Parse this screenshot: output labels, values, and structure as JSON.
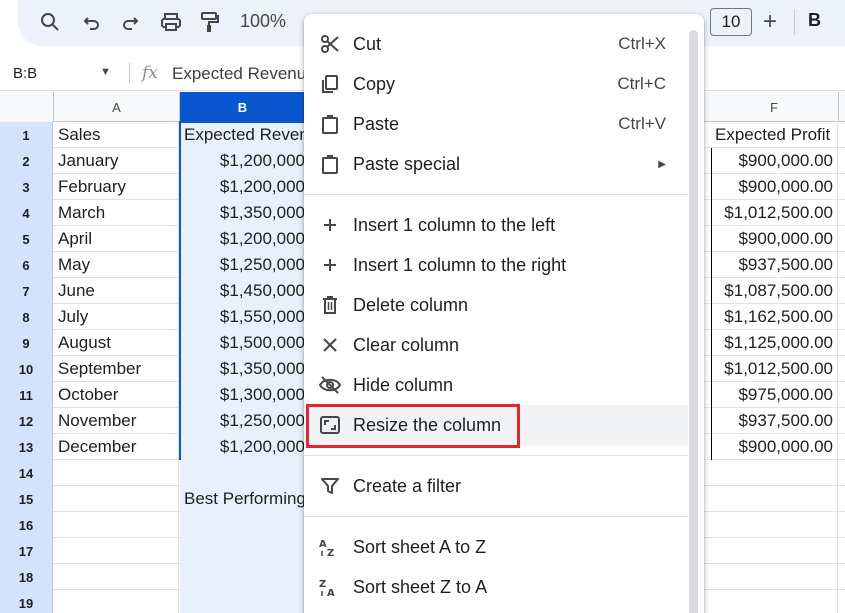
{
  "toolbar": {
    "zoom": "100%",
    "font_size": "10",
    "bold": "B",
    "plus": "+"
  },
  "formula_bar": {
    "name_box": "B:B",
    "fx": "fx",
    "content": "Expected Revenue"
  },
  "columns": {
    "a": "A",
    "b": "B",
    "f": "F"
  },
  "rows": [
    {
      "num": "1",
      "a": "Sales",
      "b": "Expected Reven",
      "f": "Expected Profit"
    },
    {
      "num": "2",
      "a": "January",
      "b": "$1,200,000",
      "f": "$900,000.00"
    },
    {
      "num": "3",
      "a": "February",
      "b": "$1,200,000",
      "f": "$900,000.00"
    },
    {
      "num": "4",
      "a": "March",
      "b": "$1,350,000",
      "f": "$1,012,500.00"
    },
    {
      "num": "5",
      "a": "April",
      "b": "$1,200,000",
      "f": "$900,000.00"
    },
    {
      "num": "6",
      "a": "May",
      "b": "$1,250,000",
      "f": "$937,500.00"
    },
    {
      "num": "7",
      "a": "June",
      "b": "$1,450,000",
      "f": "$1,087,500.00"
    },
    {
      "num": "8",
      "a": "July",
      "b": "$1,550,000",
      "f": "$1,162,500.00"
    },
    {
      "num": "9",
      "a": "August",
      "b": "$1,500,000",
      "f": "$1,125,000.00"
    },
    {
      "num": "10",
      "a": "September",
      "b": "$1,350,000",
      "f": "$1,012,500.00"
    },
    {
      "num": "11",
      "a": "October",
      "b": "$1,300,000",
      "f": "$975,000.00"
    },
    {
      "num": "12",
      "a": "November",
      "b": "$1,250,000",
      "f": "$937,500.00"
    },
    {
      "num": "13",
      "a": "December",
      "b": "$1,200,000",
      "f": "$900,000.00"
    },
    {
      "num": "14",
      "a": "",
      "b": "",
      "f": ""
    },
    {
      "num": "15",
      "a": "",
      "b": "Best Performing",
      "f": ""
    },
    {
      "num": "16",
      "a": "",
      "b": "",
      "f": ""
    },
    {
      "num": "17",
      "a": "",
      "b": "",
      "f": ""
    },
    {
      "num": "18",
      "a": "",
      "b": "",
      "f": ""
    },
    {
      "num": "19",
      "a": "",
      "b": "",
      "f": ""
    }
  ],
  "menu": {
    "cut": {
      "label": "Cut",
      "shortcut": "Ctrl+X"
    },
    "copy": {
      "label": "Copy",
      "shortcut": "Ctrl+C"
    },
    "paste": {
      "label": "Paste",
      "shortcut": "Ctrl+V"
    },
    "paste_special": {
      "label": "Paste special"
    },
    "insert_left": {
      "label": "Insert 1 column to the left"
    },
    "insert_right": {
      "label": "Insert 1 column to the right"
    },
    "delete_column": {
      "label": "Delete column"
    },
    "clear_column": {
      "label": "Clear column"
    },
    "hide_column": {
      "label": "Hide column"
    },
    "resize_column": {
      "label": "Resize the column"
    },
    "create_filter": {
      "label": "Create a filter"
    },
    "sort_az": {
      "label": "Sort sheet A to Z"
    },
    "sort_za": {
      "label": "Sort sheet Z to A"
    }
  },
  "colors": {
    "selection_blue": "#0b57d0",
    "selected_fill": "#e8f0fe",
    "highlight_red": "#e3262f"
  }
}
